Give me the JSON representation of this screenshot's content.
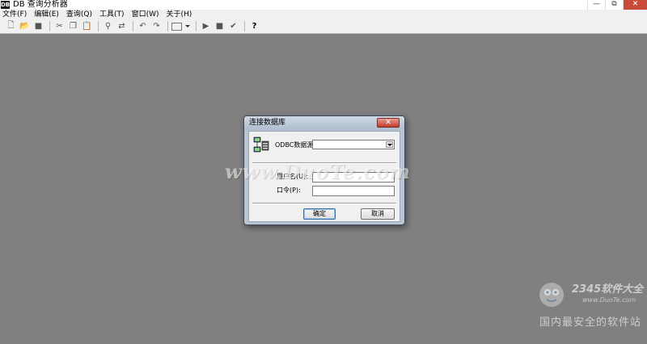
{
  "app": {
    "icon_text": "DB",
    "title": "DB 查询分析器"
  },
  "window_controls": [
    "—",
    "⧉",
    "✕"
  ],
  "menu": [
    {
      "label": "文件(F)"
    },
    {
      "label": "编辑(E)"
    },
    {
      "label": "查询(Q)"
    },
    {
      "label": "工具(T)"
    },
    {
      "label": "窗口(W)"
    },
    {
      "label": "关于(H)"
    }
  ],
  "toolbar": {
    "buttons": [
      {
        "icon": "new-icon",
        "glyph": "🗋"
      },
      {
        "icon": "open-icon",
        "glyph": "📂"
      },
      {
        "icon": "save-icon",
        "glyph": "■"
      },
      {
        "icon": "cut-icon",
        "glyph": "✂"
      },
      {
        "icon": "copy-icon",
        "glyph": "❐"
      },
      {
        "icon": "paste-icon",
        "glyph": "📋"
      },
      {
        "icon": "find-icon",
        "glyph": "⚲"
      },
      {
        "icon": "replace-icon",
        "glyph": "⇄"
      },
      {
        "icon": "undo-icon",
        "glyph": "↶"
      },
      {
        "icon": "redo-icon",
        "glyph": "↷"
      },
      {
        "icon": "execute-icon",
        "glyph": "▶"
      },
      {
        "icon": "stop-icon",
        "glyph": "■"
      },
      {
        "icon": "parse-icon",
        "glyph": "✔"
      },
      {
        "icon": "help-icon",
        "glyph": "?"
      }
    ]
  },
  "dialog": {
    "title": "连接数据库",
    "close_glyph": "✕",
    "odbc_label": "ODBC数据源:",
    "odbc_value": "",
    "user_label": "用户名(U):",
    "user_value": "",
    "password_label": "口令(P):",
    "password_value": "",
    "ok_label": "确定",
    "cancel_label": "取消"
  },
  "watermarks": {
    "center": "www.DuoTe.com",
    "brand": "2345软件大全",
    "brand_url": "www.DuoTe.com",
    "slogan": "国内最安全的软件站"
  },
  "colors": {
    "workspace": "#808080",
    "dialog_frame": "#b9c5d3",
    "close_button": "#c23b2c"
  }
}
